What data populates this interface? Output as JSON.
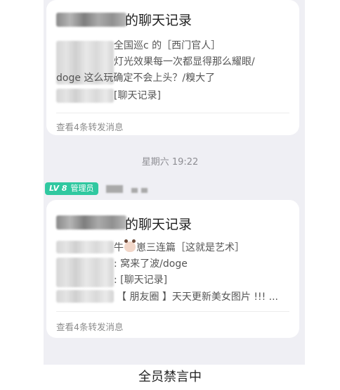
{
  "card1": {
    "title": "的聊天记录",
    "lines": [
      "全国巡c 的［西门官人］",
      "灯光效果每一次都显得那么耀眼/",
      "doge 这么玩确定不会上头？/糗大了",
      "[聊天记录]"
    ],
    "view_more": "查看4条转发消息"
  },
  "timestamp": "星期六 19:22",
  "sender": {
    "level": "LV 8",
    "role": "管理员"
  },
  "card2": {
    "title": "的聊天记录",
    "lines": [
      "牛",
      "崽三连篇［这就是艺术］",
      ": 窝来了波/doge",
      ": [聊天记录]",
      "【 朋友圈 】天天更新美女图片 !!! ..."
    ],
    "view_more": "查看4条转发消息"
  },
  "footer": {
    "status": "全员禁言中"
  },
  "icons": {
    "cow": "cow-face-icon"
  }
}
